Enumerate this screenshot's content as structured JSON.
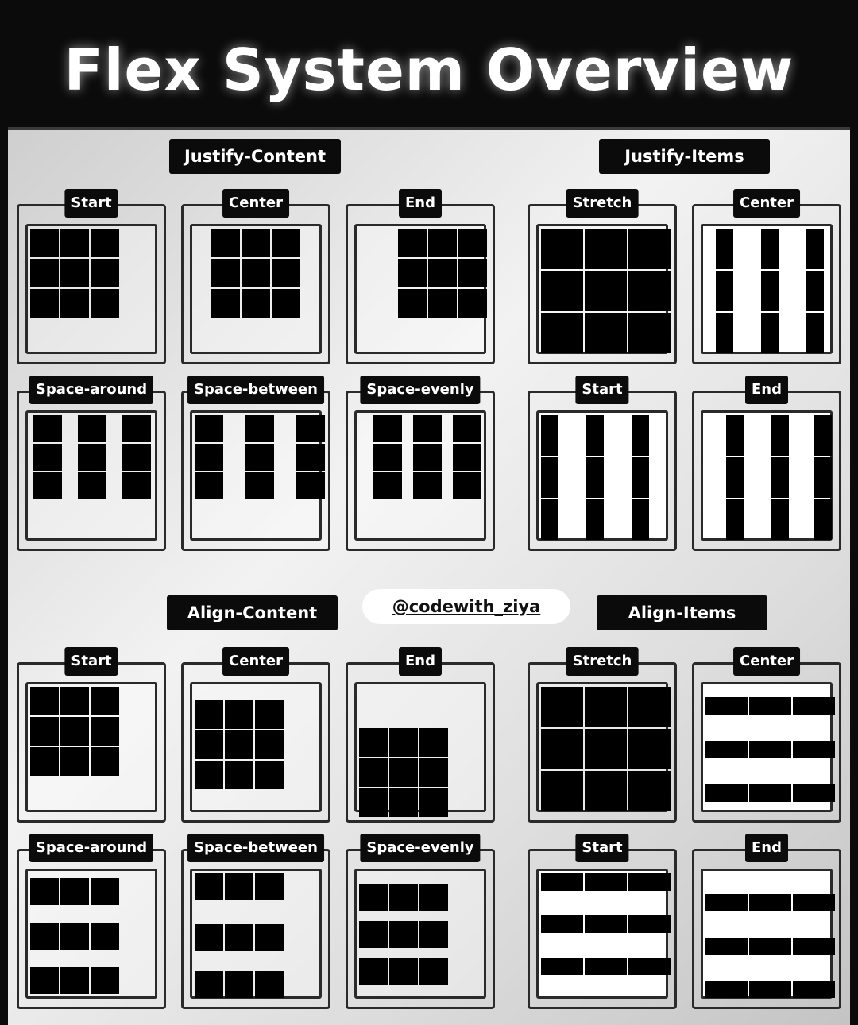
{
  "title": "Flex System Overview",
  "watermark": "@codewith_ziya",
  "sections": {
    "justify_content": "Justify-Content",
    "justify_items": "Justify-Items",
    "align_content": "Align-Content",
    "align_items": "Align-Items"
  },
  "cards": {
    "jc_start": "Start",
    "jc_center": "Center",
    "jc_end": "End",
    "jc_space_around": "Space-around",
    "jc_space_between": "Space-between",
    "jc_space_evenly": "Space-evenly",
    "ji_stretch": "Stretch",
    "ji_center": "Center",
    "ji_start": "Start",
    "ji_end": "End",
    "ac_start": "Start",
    "ac_center": "Center",
    "ac_end": "End",
    "ac_space_around": "Space-around",
    "ac_space_between": "Space-between",
    "ac_space_evenly": "Space-evenly",
    "ai_stretch": "Stretch",
    "ai_center": "Center",
    "ai_start": "Start",
    "ai_end": "End"
  },
  "colors": {
    "background": "#0b0b0b",
    "cell": "#000000",
    "label_bg": "#0b0b0b",
    "label_text": "#ffffff"
  }
}
